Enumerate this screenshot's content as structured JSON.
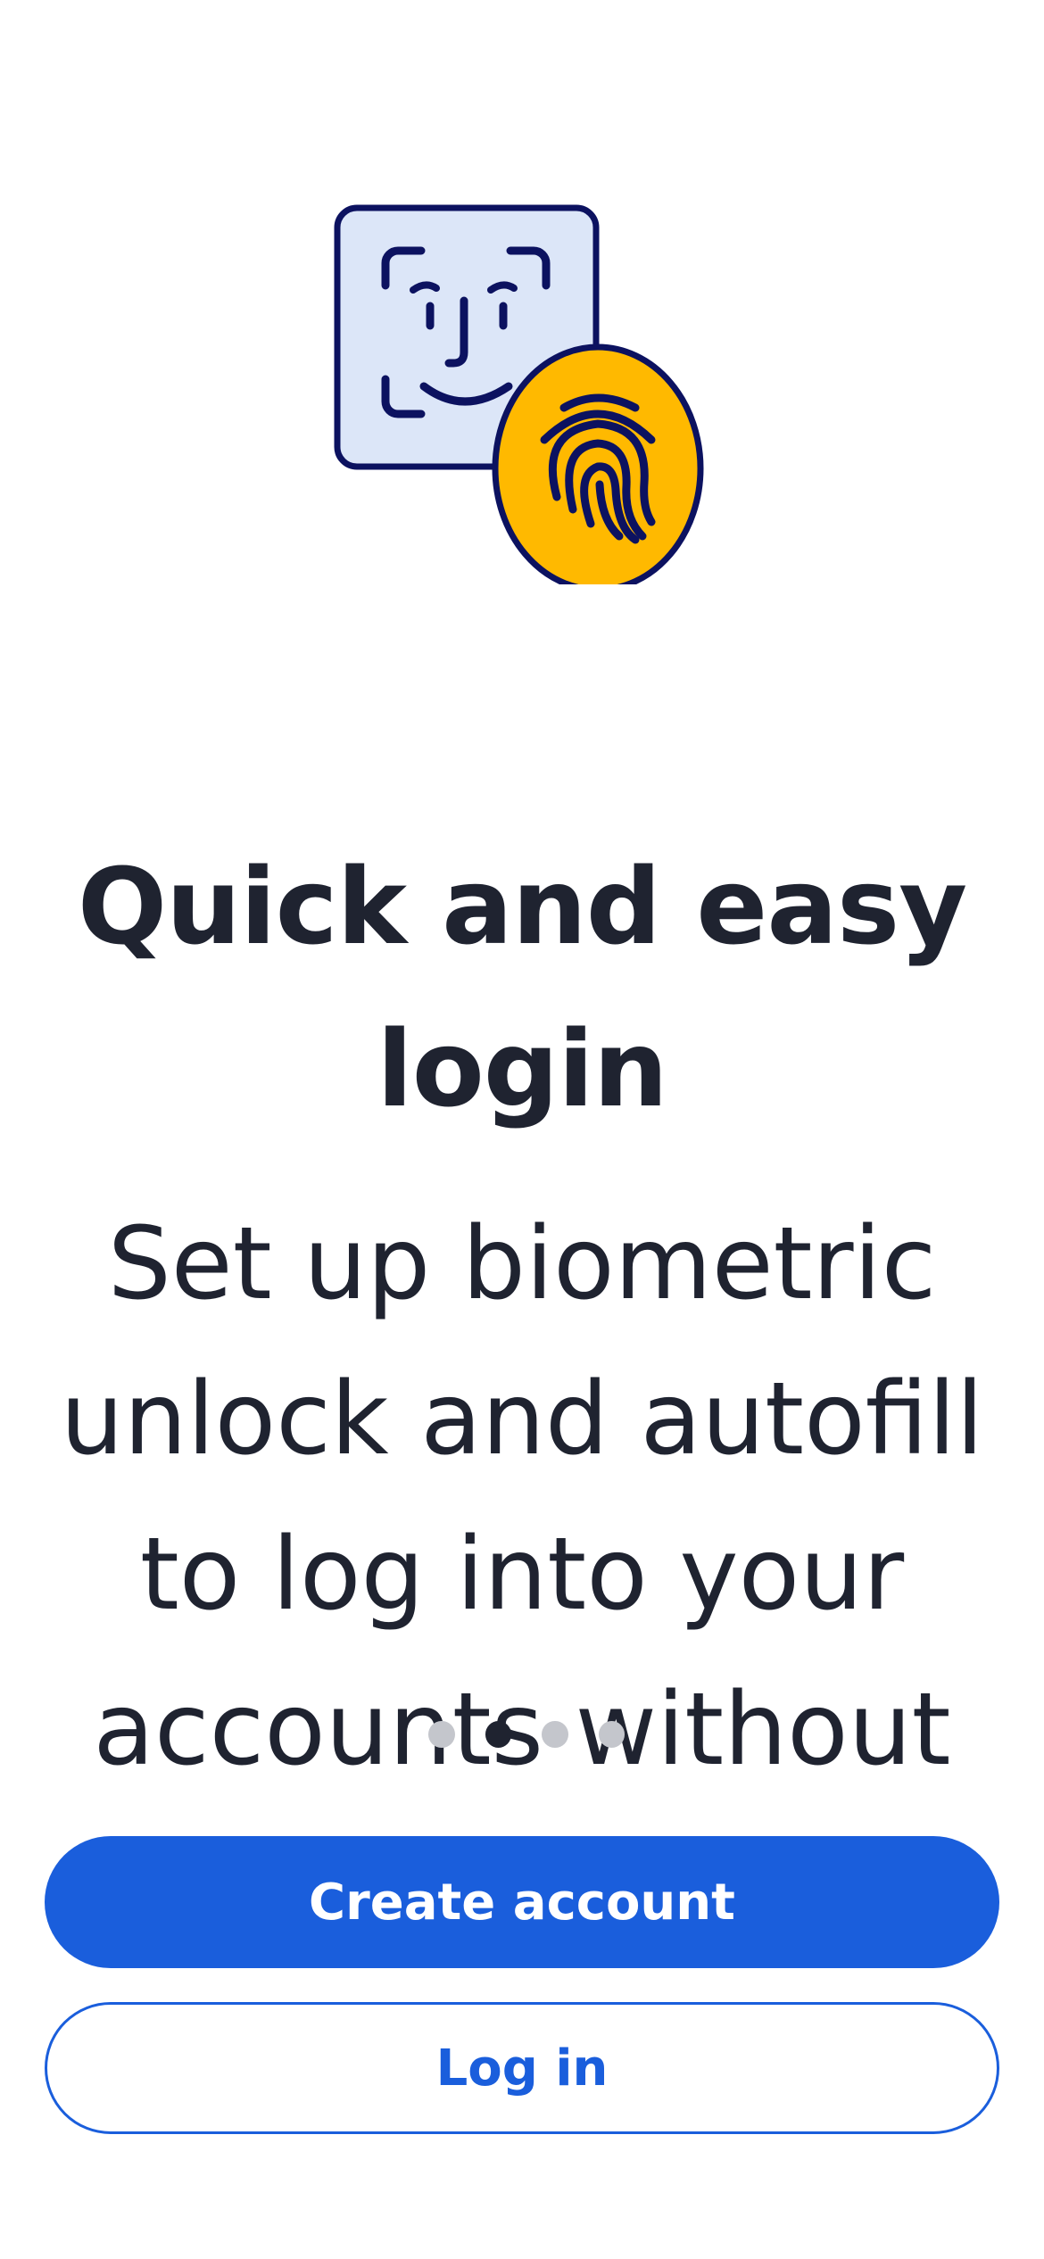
{
  "illustration": {
    "face_icon": "face-id-icon",
    "fingerprint_icon": "fingerprint-icon"
  },
  "onboarding": {
    "title": "Quick and easy login",
    "description": "Set up biometric unlock and autofill to log into your accounts without",
    "page_index": 2,
    "page_count": 4
  },
  "actions": {
    "create_account_label": "Create account",
    "login_label": "Log in"
  },
  "colors": {
    "primary": "#1a5edc",
    "text": "#1f2330",
    "accent_yellow": "#ffb900",
    "tile_blue": "#dce6f8",
    "outline_navy": "#0c1260"
  }
}
